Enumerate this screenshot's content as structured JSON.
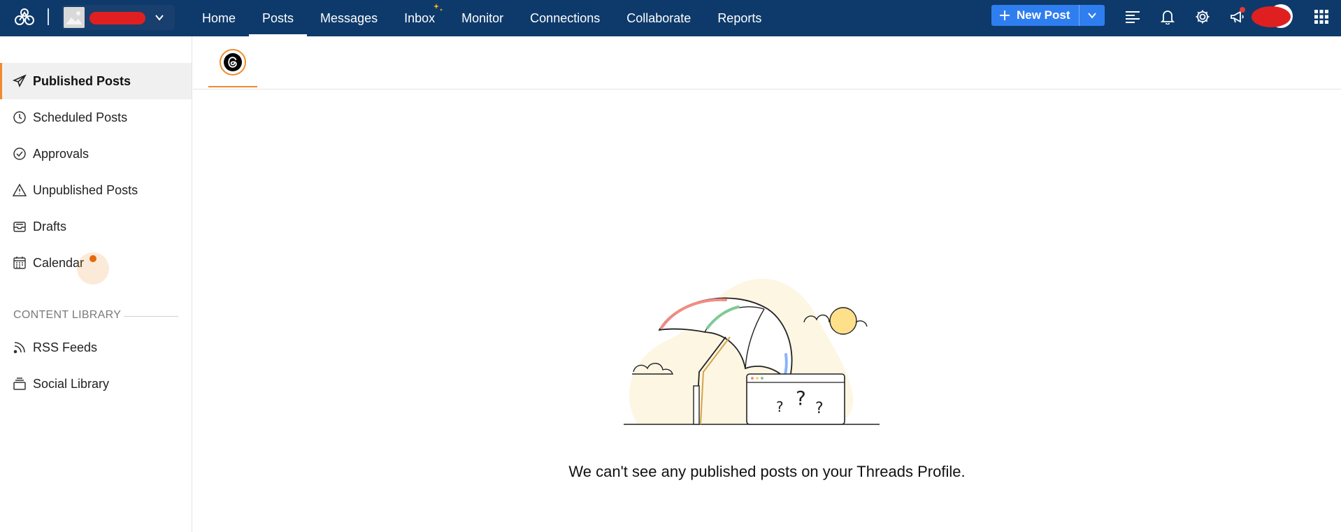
{
  "topbar": {
    "background": "#0e3a6b",
    "nav": [
      {
        "label": "Home"
      },
      {
        "label": "Posts",
        "active": true
      },
      {
        "label": "Messages"
      },
      {
        "label": "Inbox"
      },
      {
        "label": "Monitor"
      },
      {
        "label": "Connections"
      },
      {
        "label": "Collaborate"
      },
      {
        "label": "Reports"
      }
    ],
    "new_post_label": "New Post",
    "icons": [
      "list-icon",
      "bell-icon",
      "gear-icon",
      "megaphone-icon",
      "apps-grid-icon"
    ]
  },
  "sidebar": {
    "items": [
      {
        "label": "Published Posts",
        "icon": "paper-plane-icon",
        "active": true
      },
      {
        "label": "Scheduled Posts",
        "icon": "clock-icon"
      },
      {
        "label": "Approvals",
        "icon": "check-circle-icon"
      },
      {
        "label": "Unpublished Posts",
        "icon": "warning-icon"
      },
      {
        "label": "Drafts",
        "icon": "inbox-tray-icon"
      },
      {
        "label": "Calendar",
        "icon": "calendar-icon"
      }
    ],
    "section_title": "CONTENT LIBRARY",
    "library_items": [
      {
        "label": "RSS Feeds",
        "icon": "rss-icon"
      },
      {
        "label": "Social Library",
        "icon": "stack-icon"
      }
    ]
  },
  "main": {
    "active_profile": "threads-profile-icon",
    "empty_message": "We can't see any published posts on your Threads Profile."
  },
  "colors": {
    "accent": "#f08a2c",
    "primary_button": "#2f7ef0",
    "active_row": "#f0f0f0"
  }
}
